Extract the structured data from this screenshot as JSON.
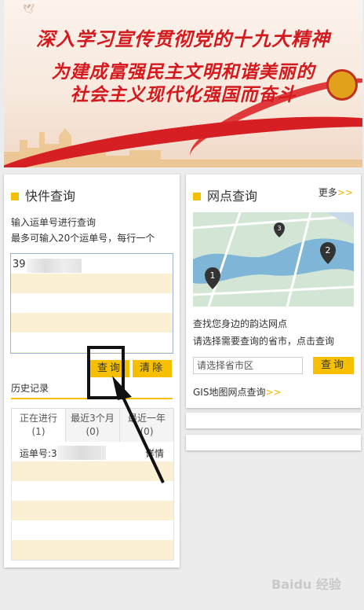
{
  "banner": {
    "line1": "深入学习宣传贯彻党的十九大精神",
    "line2": "为建成富强民主文明和谐美丽的",
    "line3": "社会主义现代化强国而奋斗"
  },
  "express": {
    "title": "快件查询",
    "hint1": "输入运单号进行查询",
    "hint2": "最多可输入20个运单号，每行一个",
    "input_value": "39            22",
    "query_label": "查询",
    "clear_label": "清除"
  },
  "history": {
    "title": "历史记录",
    "tabs": [
      {
        "label": "正在进行",
        "count": "(1)"
      },
      {
        "label": "最近3个月",
        "count": "(0)"
      },
      {
        "label": "最近一年",
        "count": "(0)"
      }
    ],
    "row_label": "运单号:39              22",
    "row_detail": "详情"
  },
  "outlet": {
    "title": "网点查询",
    "more": "更多",
    "more_arrow": ">>",
    "desc1": "查找您身边的韵达网点",
    "desc2": "请选择需要查询的省市，点击查询",
    "city_placeholder": "请选择省市区",
    "query_label": "查询",
    "gis_link": "GIS地图网点查询",
    "gis_arrow": ">>",
    "map_pins": [
      "1",
      "2",
      "3"
    ]
  },
  "watermark": "Baidu 经验",
  "colors": {
    "accent": "#f6c000",
    "banner_red": "#d41a1f"
  }
}
